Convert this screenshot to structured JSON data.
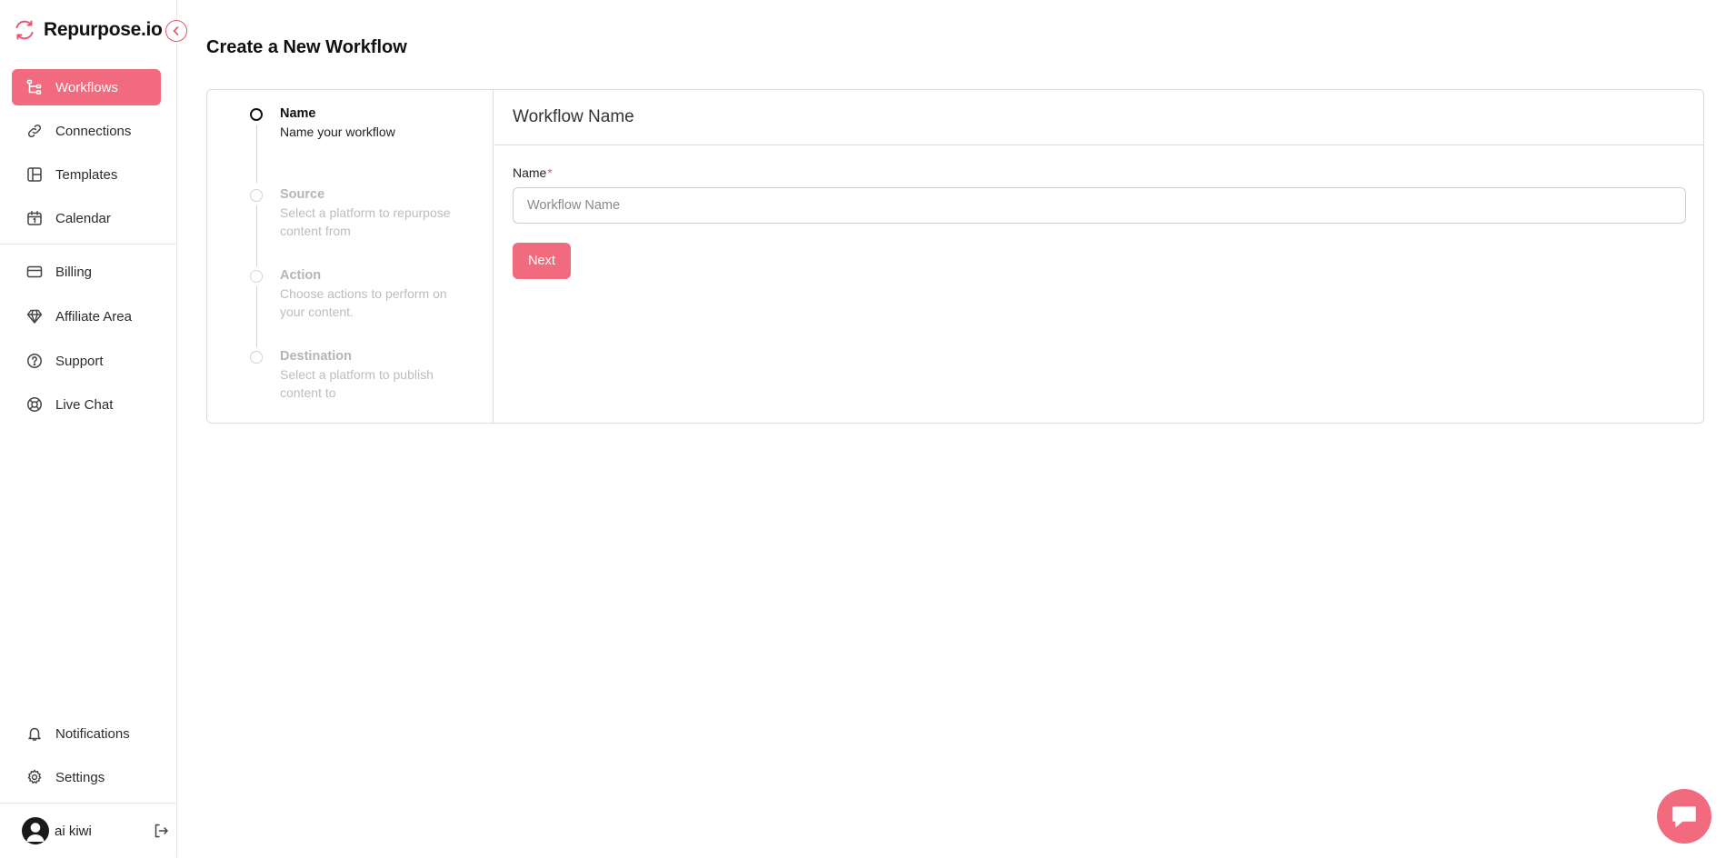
{
  "brand": {
    "name": "Repurpose.io",
    "logo_icon": "refresh-arrows-icon",
    "accent_color": "#f26a7e"
  },
  "sidebar": {
    "collapse_icon": "chevron-left-icon",
    "primary_items": [
      {
        "label": "Workflows",
        "icon": "workflow-icon",
        "active": true
      },
      {
        "label": "Connections",
        "icon": "link-icon",
        "active": false
      },
      {
        "label": "Templates",
        "icon": "layout-icon",
        "active": false
      },
      {
        "label": "Calendar",
        "icon": "calendar-icon",
        "active": false
      }
    ],
    "secondary_items": [
      {
        "label": "Billing",
        "icon": "credit-card-icon"
      },
      {
        "label": "Affiliate Area",
        "icon": "diamond-icon"
      },
      {
        "label": "Support",
        "icon": "help-circle-icon"
      },
      {
        "label": "Live Chat",
        "icon": "life-buoy-icon"
      }
    ],
    "bottom_items": [
      {
        "label": "Notifications",
        "icon": "bell-icon"
      },
      {
        "label": "Settings",
        "icon": "gear-icon"
      }
    ],
    "user": {
      "name": "ai kiwi",
      "avatar_icon": "user-avatar-icon",
      "logout_icon": "logout-icon"
    }
  },
  "page": {
    "title": "Create a New Workflow"
  },
  "steps": [
    {
      "title": "Name",
      "description": "Name your workflow",
      "state": "current"
    },
    {
      "title": "Source",
      "description": "Select a platform to repurpose content from",
      "state": "upcoming"
    },
    {
      "title": "Action",
      "description": "Choose actions to perform on your content.",
      "state": "upcoming"
    },
    {
      "title": "Destination",
      "description": "Select a platform to publish content to",
      "state": "upcoming"
    }
  ],
  "form": {
    "header": "Workflow Name",
    "name_label": "Name",
    "required_marker": "*",
    "name_value": "",
    "name_placeholder": "Workflow Name",
    "next_label": "Next"
  },
  "chat_widget": {
    "icon": "chat-bubble-icon"
  }
}
